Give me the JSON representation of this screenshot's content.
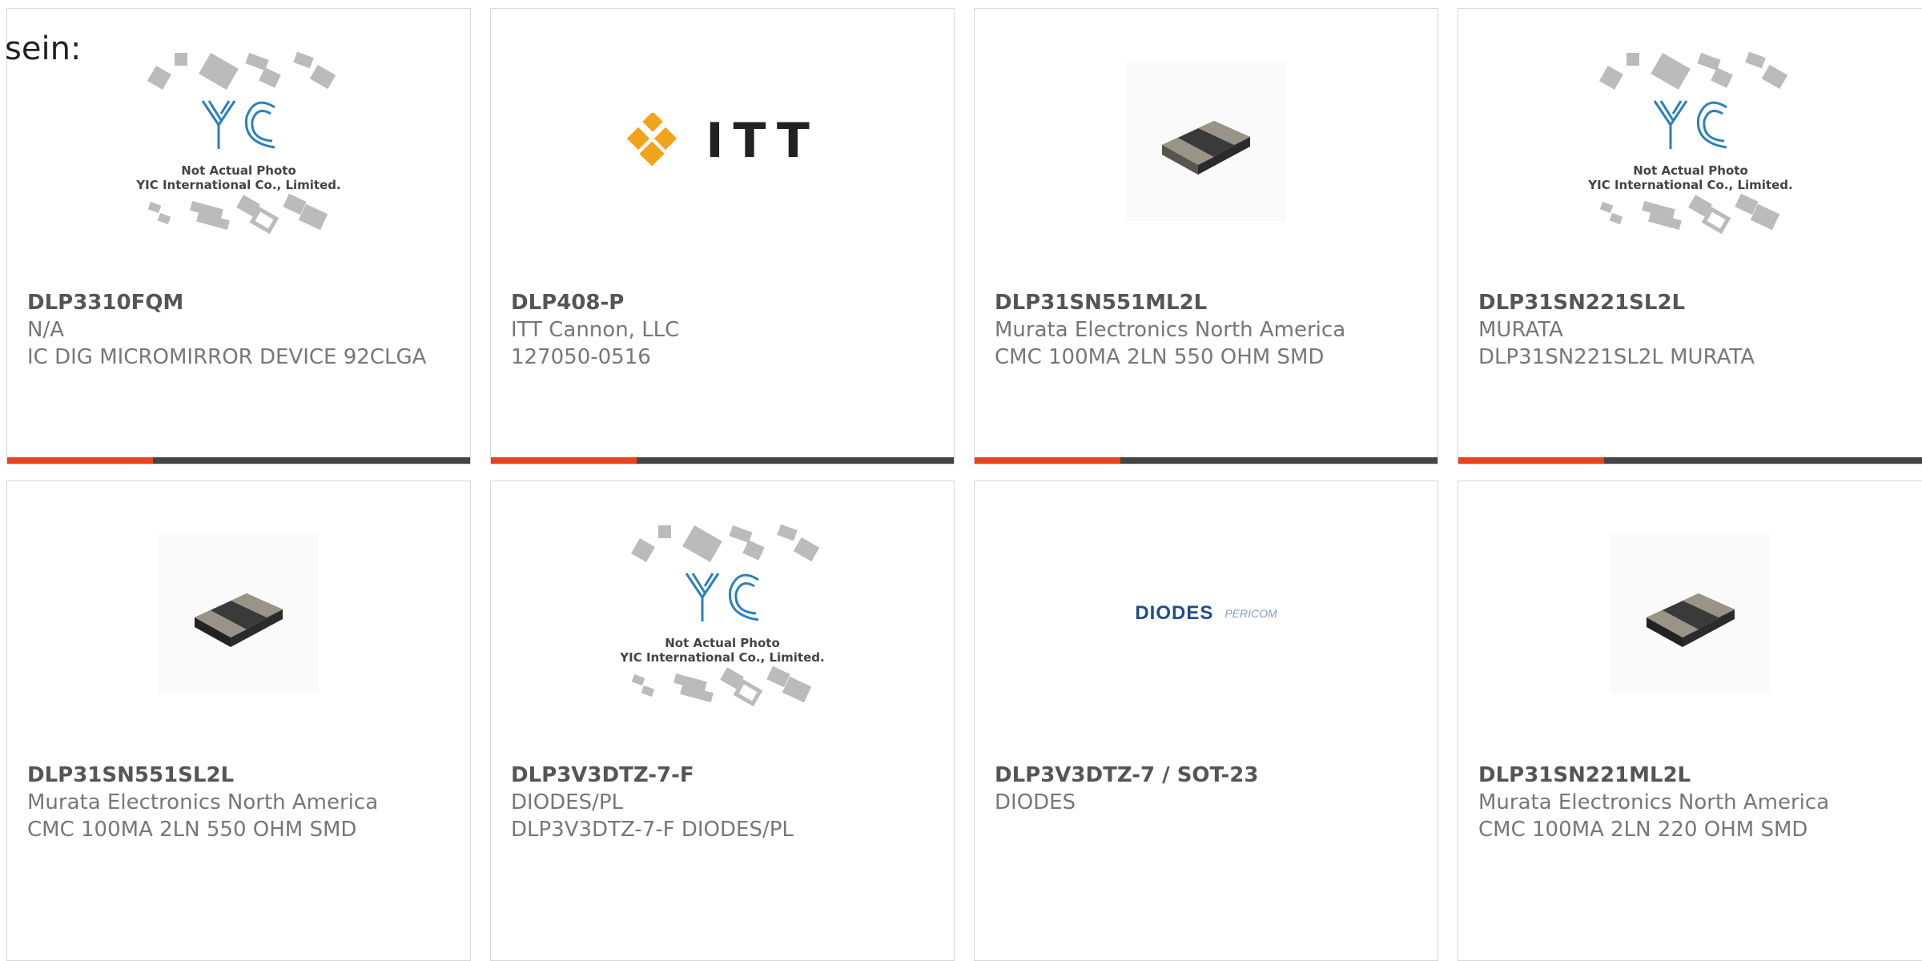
{
  "intro_text": "sein:",
  "placeholder_image": {
    "line1": "Not Actual Photo",
    "line2": "YIC International Co., Limited.",
    "logo_text": "YIC"
  },
  "brand_logos": {
    "itt": "ITT",
    "diodes": "DIODES",
    "pericom": "PERICOM"
  },
  "colors": {
    "accent": "#e8431c",
    "bar": "#444444",
    "part_number": "#555555",
    "text": "#777777"
  },
  "products": [
    {
      "part_number": "DLP3310FQM",
      "manufacturer": "N/A",
      "description": "IC DIG MICROMIRROR DEVICE 92CLGA",
      "image": "yic-placeholder"
    },
    {
      "part_number": "DLP408-P",
      "manufacturer": "ITT Cannon, LLC",
      "description": "127050-0516",
      "image": "itt-logo"
    },
    {
      "part_number": "DLP31SN551ML2L",
      "manufacturer": "Murata Electronics North America",
      "description": "CMC 100MA 2LN 550 OHM SMD",
      "image": "murata-chip"
    },
    {
      "part_number": "DLP31SN221SL2L",
      "manufacturer": "MURATA",
      "description": "DLP31SN221SL2L MURATA",
      "image": "yic-placeholder"
    },
    {
      "part_number": "DLP31SN551SL2L",
      "manufacturer": "Murata Electronics North America",
      "description": "CMC 100MA 2LN 550 OHM SMD",
      "image": "murata-chip"
    },
    {
      "part_number": "DLP3V3DTZ-7-F",
      "manufacturer": "DIODES/PL",
      "description": "DLP3V3DTZ-7-F DIODES/PL",
      "image": "yic-placeholder"
    },
    {
      "part_number": "DLP3V3DTZ-7 / SOT-23",
      "manufacturer": "DIODES",
      "description": "",
      "image": "diodes-logo"
    },
    {
      "part_number": "DLP31SN221ML2L",
      "manufacturer": "Murata Electronics North America",
      "description": "CMC 100MA 2LN 220 OHM SMD",
      "image": "murata-chip"
    }
  ]
}
